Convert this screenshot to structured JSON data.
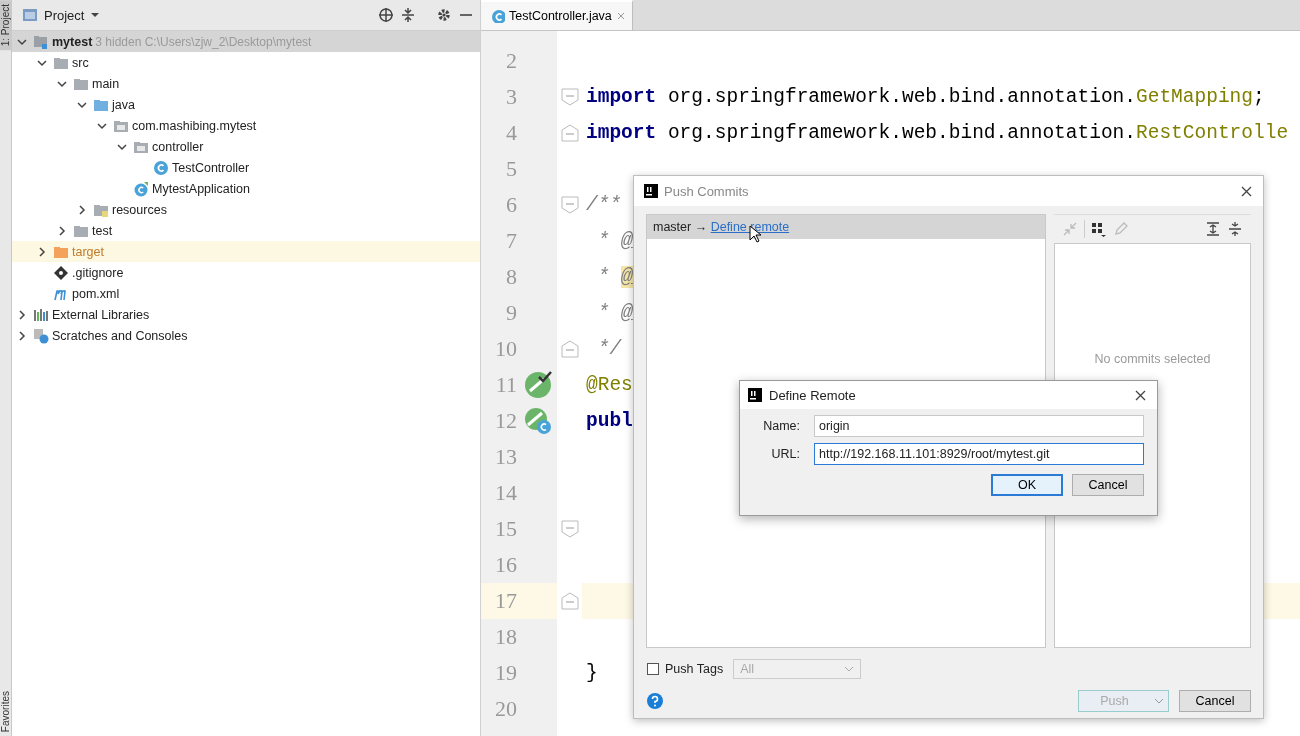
{
  "tool_stripe": [
    {
      "label": "1: Project",
      "selected": true
    },
    {
      "label": "Favorites",
      "selected": false
    }
  ],
  "project_panel": {
    "title": "Project",
    "tree": [
      {
        "label": "mytest",
        "note": "3 hidden  C:\\Users\\zjw_2\\Desktop\\mytest",
        "kind": "module",
        "expanded": true,
        "selected": true,
        "highlighted": false,
        "children": [
          {
            "label": "src",
            "kind": "folder",
            "expanded": true,
            "selected": false,
            "highlighted": false,
            "children": [
              {
                "label": "main",
                "kind": "folder",
                "expanded": true,
                "selected": false,
                "highlighted": false,
                "children": [
                  {
                    "label": "java",
                    "kind": "source-folder",
                    "expanded": true,
                    "selected": false,
                    "highlighted": false,
                    "children": [
                      {
                        "label": "com.mashibing.mytest",
                        "kind": "package",
                        "expanded": true,
                        "selected": false,
                        "highlighted": false,
                        "children": [
                          {
                            "label": "controller",
                            "kind": "package",
                            "expanded": true,
                            "selected": false,
                            "highlighted": false,
                            "children": [
                              {
                                "label": "TestController",
                                "kind": "class",
                                "selected": false,
                                "highlighted": false
                              }
                            ]
                          },
                          {
                            "label": "MytestApplication",
                            "kind": "app-class",
                            "selected": false,
                            "highlighted": false
                          }
                        ]
                      }
                    ]
                  },
                  {
                    "label": "resources",
                    "kind": "resource-folder",
                    "expanded": false,
                    "selected": false,
                    "highlighted": false
                  }
                ]
              },
              {
                "label": "test",
                "kind": "folder",
                "expanded": false,
                "selected": false,
                "highlighted": false
              }
            ]
          },
          {
            "label": "target",
            "kind": "excluded-folder",
            "expanded": false,
            "selected": false,
            "highlighted": true
          },
          {
            "label": ".gitignore",
            "kind": "git-file",
            "selected": false,
            "highlighted": false
          },
          {
            "label": "pom.xml",
            "kind": "maven-file",
            "selected": false,
            "highlighted": false
          }
        ]
      },
      {
        "label": "External Libraries",
        "kind": "libraries",
        "expanded": false,
        "selected": false,
        "highlighted": false
      },
      {
        "label": "Scratches and Consoles",
        "kind": "scratches",
        "expanded": false,
        "selected": false,
        "highlighted": false
      }
    ]
  },
  "editor": {
    "tabs": [
      {
        "label": "TestController.java",
        "selected": true
      }
    ],
    "lines": [
      {
        "number": "2",
        "current": false
      },
      {
        "number": "3",
        "current": false,
        "markers": [
          {
            "kind": "fold-start"
          }
        ],
        "tokens": [
          {
            "kind": "keyword",
            "text": "import"
          },
          {
            "kind": "plain",
            "text": " org.springframework.web.bind.annotation."
          },
          {
            "kind": "class-ref",
            "text": "GetMapping"
          },
          {
            "kind": "plain",
            "text": ";"
          }
        ]
      },
      {
        "number": "4",
        "current": false,
        "markers": [
          {
            "kind": "fold-end"
          }
        ],
        "tokens": [
          {
            "kind": "keyword",
            "text": "import"
          },
          {
            "kind": "plain",
            "text": " org.springframework.web.bind.annotation."
          },
          {
            "kind": "class-ref",
            "text": "RestControlle"
          }
        ]
      },
      {
        "number": "5",
        "current": false
      },
      {
        "number": "6",
        "current": false,
        "markers": [
          {
            "kind": "fold-start"
          }
        ],
        "tokens": [
          {
            "kind": "comment",
            "text": "/**"
          }
        ]
      },
      {
        "number": "7",
        "current": false,
        "tokens": [
          {
            "kind": "comment",
            "text": " * "
          },
          {
            "kind": "doc-tag",
            "text": "@"
          }
        ]
      },
      {
        "number": "8",
        "current": false,
        "tokens": [
          {
            "kind": "comment",
            "text": " * "
          },
          {
            "kind": "doc-tag-marked",
            "text": "@"
          }
        ]
      },
      {
        "number": "9",
        "current": false,
        "tokens": [
          {
            "kind": "comment",
            "text": " * "
          },
          {
            "kind": "doc-tag",
            "text": "@"
          }
        ]
      },
      {
        "number": "10",
        "current": false,
        "markers": [
          {
            "kind": "fold-end"
          }
        ],
        "tokens": [
          {
            "kind": "comment",
            "text": " */"
          }
        ]
      },
      {
        "number": "11",
        "current": false,
        "markers": [
          {
            "kind": "bean-check"
          }
        ],
        "tokens": [
          {
            "kind": "annotation",
            "text": "@Res"
          }
        ]
      },
      {
        "number": "12",
        "current": false,
        "markers": [
          {
            "kind": "bean-class"
          }
        ],
        "tokens": [
          {
            "kind": "keyword",
            "text": "publ"
          }
        ]
      },
      {
        "number": "13",
        "current": false
      },
      {
        "number": "14",
        "current": false
      },
      {
        "number": "15",
        "current": false,
        "markers": [
          {
            "kind": "fold-start"
          }
        ]
      },
      {
        "number": "16",
        "current": false
      },
      {
        "number": "17",
        "current": true,
        "markers": [
          {
            "kind": "fold-end"
          }
        ]
      },
      {
        "number": "18",
        "current": false
      },
      {
        "number": "19",
        "current": false,
        "tokens": [
          {
            "kind": "plain",
            "text": "}"
          }
        ]
      },
      {
        "number": "20",
        "current": false
      }
    ]
  },
  "push_dialog": {
    "title": "Push Commits",
    "branches": [
      {
        "branch": "master",
        "arrow": "→",
        "remote_link": "Define remote",
        "selected": true
      }
    ],
    "empty_message": "No commits selected",
    "push_tags": {
      "label": "Push Tags",
      "checked": false
    },
    "tags_dropdown": {
      "value": "All",
      "disabled": true
    },
    "buttons": [
      {
        "label": "Push",
        "kind": "split",
        "disabled": true
      },
      {
        "label": "Cancel",
        "kind": "plain",
        "disabled": false
      }
    ]
  },
  "define_remote_dialog": {
    "title": "Define Remote",
    "fields": [
      {
        "label": "Name:",
        "value": "origin",
        "focused": false
      },
      {
        "label": "URL:",
        "value": "http://192.168.11.101:8929/root/mytest.git",
        "focused": true
      }
    ],
    "buttons": [
      {
        "label": "OK",
        "default": true
      },
      {
        "label": "Cancel",
        "default": false
      }
    ]
  }
}
